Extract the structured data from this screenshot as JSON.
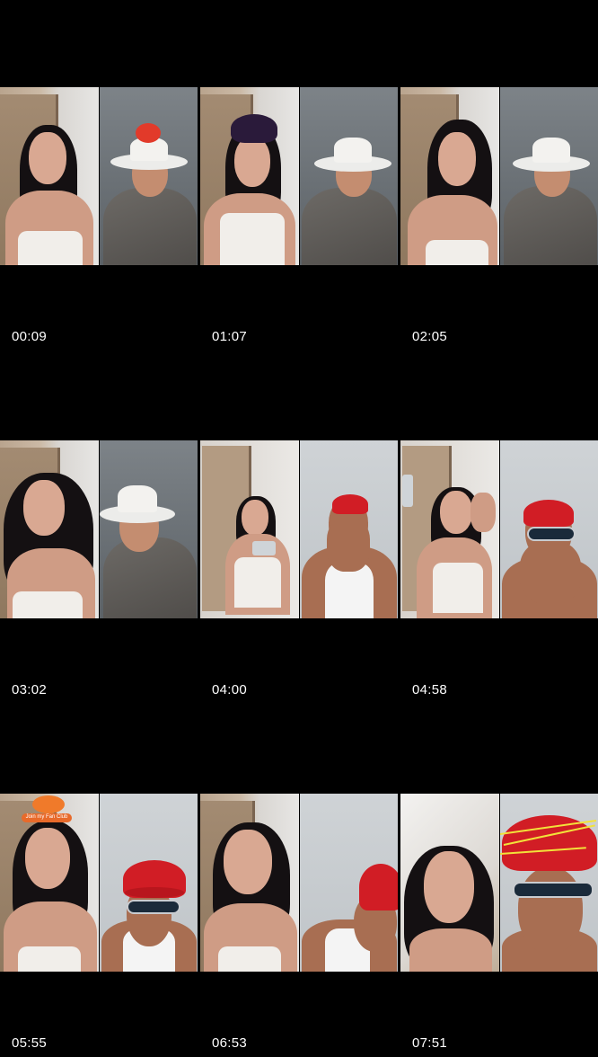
{
  "thumbnails": [
    {
      "timestamp": "00:09"
    },
    {
      "timestamp": "01:07"
    },
    {
      "timestamp": "02:05"
    },
    {
      "timestamp": "03:02"
    },
    {
      "timestamp": "04:00"
    },
    {
      "timestamp": "04:58"
    },
    {
      "timestamp": "05:55"
    },
    {
      "timestamp": "06:53"
    },
    {
      "timestamp": "07:51"
    }
  ],
  "badge": {
    "fan_club_label": "Join my Fan Club"
  },
  "colors": {
    "background": "#000000",
    "timestamp_text": "#ffffff",
    "cap_red": "#d11d25",
    "hat_white": "#f3f2ef"
  }
}
